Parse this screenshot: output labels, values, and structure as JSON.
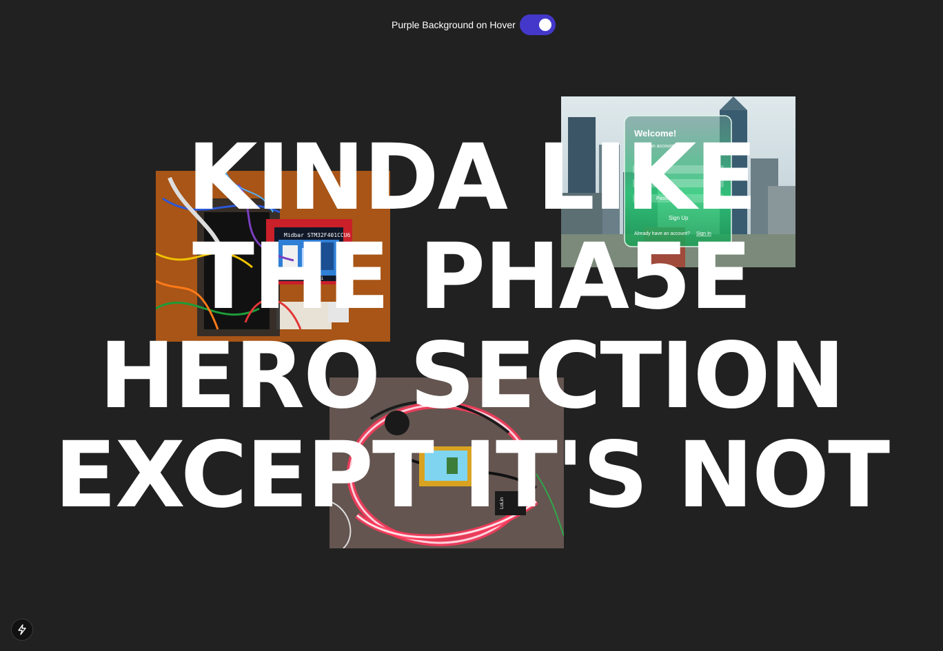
{
  "toggle": {
    "label": "Purple Background on Hover",
    "state": "on",
    "accent_color": "#4338ca"
  },
  "headline": {
    "lines": [
      "KINDA LIKE",
      "THE PHA5E",
      "HERO SECTION",
      "EXCEPT IT'S NOT"
    ]
  },
  "images": {
    "electronics": {
      "screen_title": "Midbar STM32F401CCU6",
      "screen_footer": "ard Mi"
    },
    "city": {
      "card_title": "Welcome!",
      "card_subtitle": "Create an account",
      "password_label": "Password",
      "button_label": "Sign Up",
      "footer_text": "Already have an account?",
      "footer_link": "Sign In"
    },
    "leds": {
      "board_label": "LoLin"
    }
  },
  "corner_badge": {
    "icon": "lightning-bolt-icon"
  },
  "colors": {
    "background": "#212121",
    "text": "#ffffff"
  }
}
